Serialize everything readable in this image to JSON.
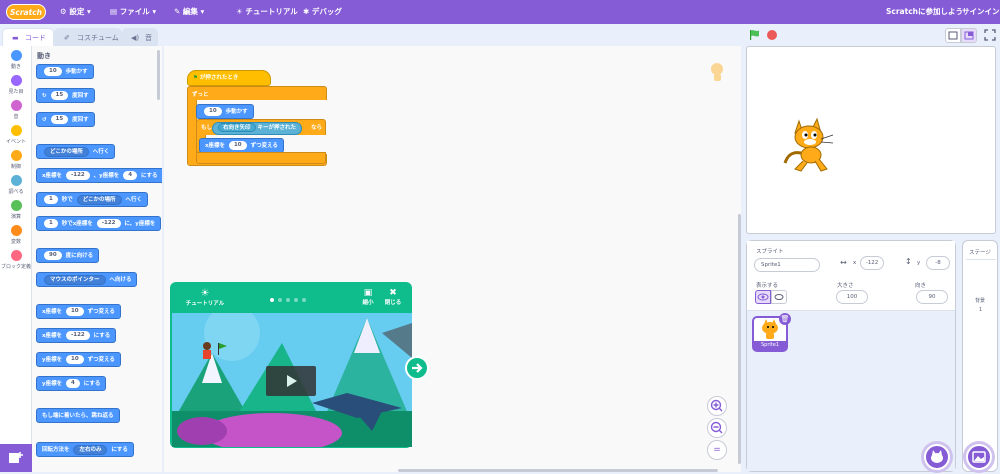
{
  "menubar": {
    "logo": "Scratch",
    "settings": "設定",
    "file": "ファイル",
    "edit": "編集",
    "tutorial": "チュートリアル",
    "debug": "デバッグ",
    "join": "Scratchに参加しよう",
    "signin": "サインイン",
    "accent": "#855cd6"
  },
  "tabs": {
    "code": "コード",
    "costume": "コスチューム",
    "sound": "音"
  },
  "categories": [
    {
      "label": "動き",
      "color": "#4c97ff"
    },
    {
      "label": "見た目",
      "color": "#9966ff"
    },
    {
      "label": "音",
      "color": "#cf63cf"
    },
    {
      "label": "イベント",
      "color": "#ffbf00"
    },
    {
      "label": "制御",
      "color": "#ffab19"
    },
    {
      "label": "調べる",
      "color": "#5cb1d6"
    },
    {
      "label": "演算",
      "color": "#59c059"
    },
    {
      "label": "変数",
      "color": "#ff8c1a"
    },
    {
      "label": "ブロック定義",
      "color": "#ff6680"
    }
  ],
  "palette": {
    "heading": "動き",
    "move": {
      "val": "10",
      "text": "歩動かす"
    },
    "turn_right": {
      "val": "15",
      "text": "度回す"
    },
    "turn_left": {
      "val": "15",
      "text": "度回す"
    },
    "goto": {
      "dd": "どこかの場所",
      "text": "へ行く"
    },
    "goto_xy": {
      "a": "x座標を",
      "x": "-122",
      "b": "、y座標を",
      "y": "4",
      "c": "にする"
    },
    "glide": {
      "val": "1",
      "a": "秒で",
      "dd": "どこかの場所",
      "b": "へ行く"
    },
    "glide_xy": {
      "val": "1",
      "a": "秒でx座標を",
      "x": "-122",
      "b": "に、y座標を"
    },
    "point_dir": {
      "val": "90",
      "text": "度に向ける"
    },
    "point_towards": {
      "dd": "マウスのポインター",
      "text": "へ向ける"
    },
    "change_x": {
      "a": "x座標を",
      "val": "10",
      "b": "ずつ変える"
    },
    "set_x": {
      "a": "x座標を",
      "val": "-122",
      "b": "にする"
    },
    "change_y": {
      "a": "y座標を",
      "val": "10",
      "b": "ずつ変える"
    },
    "set_y": {
      "a": "y座標を",
      "val": "4",
      "b": "にする"
    },
    "bounce": "もし端に着いたら、跳ね返る",
    "rotation": {
      "a": "回転方法を",
      "dd": "左右のみ",
      "b": "にする"
    }
  },
  "script": {
    "hat": "が押されたとき",
    "forever": "ずっと",
    "move_val": "10",
    "move_text": "歩動かす",
    "if": "もし",
    "key_dd": "右向き矢印",
    "key_text": "キーが押された",
    "then": "なら",
    "changex_a": "x座標を",
    "changex_val": "10",
    "changex_b": "ずつ変える"
  },
  "tutorial": {
    "label": "チュートリアル",
    "shrink": "縮小",
    "close": "閉じる",
    "page_count": 5,
    "page_active": 1
  },
  "zoom": {
    "equal": "="
  },
  "sprite": {
    "label": "スプライト",
    "name": "Sprite1",
    "x_label": "x",
    "x": "-122",
    "y_label": "y",
    "y": "-8",
    "show_label": "表示する",
    "size_label": "大きさ",
    "size": "100",
    "direction_label": "向き",
    "direction": "90",
    "thumb_name": "Sprite1"
  },
  "stage_pane": {
    "label": "ステージ",
    "backdrop_label": "背景",
    "backdrop_count": "1"
  }
}
